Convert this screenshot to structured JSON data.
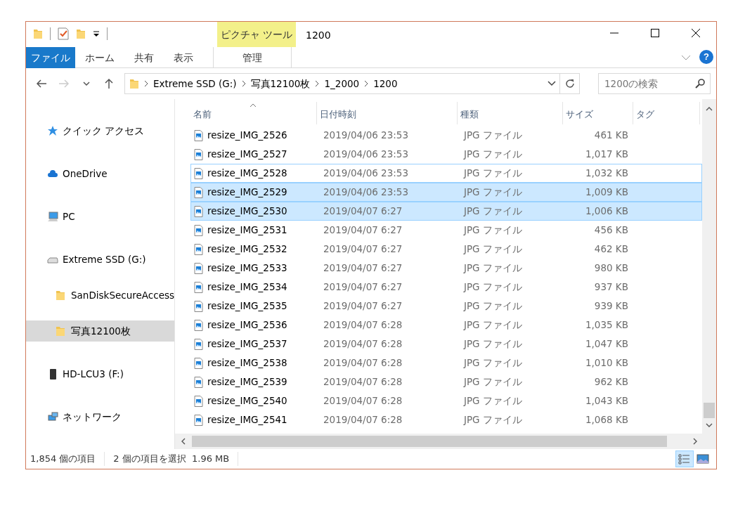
{
  "window": {
    "title": "1200",
    "context_group": "ピクチャ ツール"
  },
  "ribbon_tabs": [
    {
      "label": "ファイル",
      "kind": "file",
      "selected": false
    },
    {
      "label": "ホーム",
      "kind": "tab",
      "selected": false
    },
    {
      "label": "共有",
      "kind": "tab",
      "selected": false
    },
    {
      "label": "表示",
      "kind": "tab",
      "selected": false
    },
    {
      "label": "管理",
      "kind": "context",
      "selected": false
    }
  ],
  "help_button": "?",
  "breadcrumbs": [
    "Extreme SSD (G:)",
    "写真12100枚",
    "1_2000",
    "1200"
  ],
  "search": {
    "placeholder": "1200の検索"
  },
  "sidebar": {
    "items": [
      {
        "label": "クイック アクセス",
        "kind": "star",
        "selected": false
      },
      {
        "label": "OneDrive",
        "kind": "cloud",
        "selected": false
      },
      {
        "label": "PC",
        "kind": "pc",
        "selected": false
      },
      {
        "label": "Extreme SSD (G:)",
        "kind": "drive",
        "selected": false,
        "children": [
          {
            "label": "SanDiskSecureAccess",
            "kind": "folder",
            "selected": false
          },
          {
            "label": "写真12100枚",
            "kind": "folder",
            "selected": true
          }
        ]
      },
      {
        "label": "HD-LCU3 (F:)",
        "kind": "hdd",
        "selected": false
      },
      {
        "label": "ネットワーク",
        "kind": "network",
        "selected": false
      }
    ]
  },
  "table": {
    "columns": [
      "名前",
      "日付時刻",
      "種類",
      "サイズ",
      "タグ"
    ],
    "rows": [
      {
        "name": "resize_IMG_2526",
        "date": "2019/04/06 23:53",
        "type": "JPG ファイル",
        "size": "461 KB",
        "selected": false,
        "focused": false
      },
      {
        "name": "resize_IMG_2527",
        "date": "2019/04/06 23:53",
        "type": "JPG ファイル",
        "size": "1,017 KB",
        "selected": false,
        "focused": false
      },
      {
        "name": "resize_IMG_2528",
        "date": "2019/04/06 23:53",
        "type": "JPG ファイル",
        "size": "1,032 KB",
        "selected": false,
        "focused": true
      },
      {
        "name": "resize_IMG_2529",
        "date": "2019/04/06 23:53",
        "type": "JPG ファイル",
        "size": "1,009 KB",
        "selected": true,
        "focused": false
      },
      {
        "name": "resize_IMG_2530",
        "date": "2019/04/07 6:27",
        "type": "JPG ファイル",
        "size": "1,006 KB",
        "selected": true,
        "focused": false
      },
      {
        "name": "resize_IMG_2531",
        "date": "2019/04/07 6:27",
        "type": "JPG ファイル",
        "size": "456 KB",
        "selected": false,
        "focused": false
      },
      {
        "name": "resize_IMG_2532",
        "date": "2019/04/07 6:27",
        "type": "JPG ファイル",
        "size": "462 KB",
        "selected": false,
        "focused": false
      },
      {
        "name": "resize_IMG_2533",
        "date": "2019/04/07 6:27",
        "type": "JPG ファイル",
        "size": "980 KB",
        "selected": false,
        "focused": false
      },
      {
        "name": "resize_IMG_2534",
        "date": "2019/04/07 6:27",
        "type": "JPG ファイル",
        "size": "937 KB",
        "selected": false,
        "focused": false
      },
      {
        "name": "resize_IMG_2535",
        "date": "2019/04/07 6:27",
        "type": "JPG ファイル",
        "size": "939 KB",
        "selected": false,
        "focused": false
      },
      {
        "name": "resize_IMG_2536",
        "date": "2019/04/07 6:28",
        "type": "JPG ファイル",
        "size": "1,035 KB",
        "selected": false,
        "focused": false
      },
      {
        "name": "resize_IMG_2537",
        "date": "2019/04/07 6:28",
        "type": "JPG ファイル",
        "size": "1,047 KB",
        "selected": false,
        "focused": false
      },
      {
        "name": "resize_IMG_2538",
        "date": "2019/04/07 6:28",
        "type": "JPG ファイル",
        "size": "1,010 KB",
        "selected": false,
        "focused": false
      },
      {
        "name": "resize_IMG_2539",
        "date": "2019/04/07 6:28",
        "type": "JPG ファイル",
        "size": "962 KB",
        "selected": false,
        "focused": false
      },
      {
        "name": "resize_IMG_2540",
        "date": "2019/04/07 6:28",
        "type": "JPG ファイル",
        "size": "1,043 KB",
        "selected": false,
        "focused": false
      },
      {
        "name": "resize_IMG_2541",
        "date": "2019/04/07 6:28",
        "type": "JPG ファイル",
        "size": "1,068 KB",
        "selected": false,
        "focused": false
      }
    ]
  },
  "status_bar": {
    "item_count": "1,854 個の項目",
    "selection": "2 個の項目を選択  1.96 MB",
    "views": [
      {
        "kind": "details",
        "selected": true
      },
      {
        "kind": "thumbnails",
        "selected": false
      }
    ]
  }
}
